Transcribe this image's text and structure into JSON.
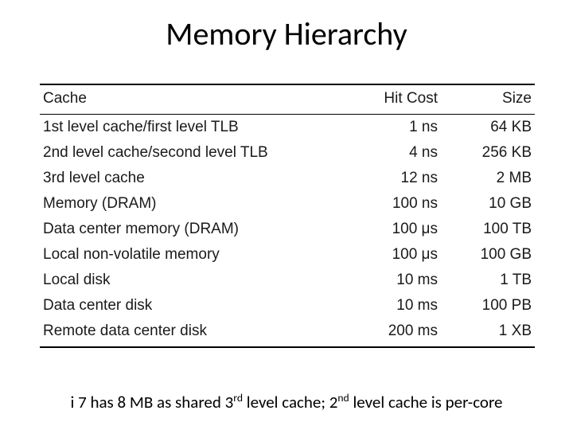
{
  "title": "Memory Hierarchy",
  "columns": {
    "cache": "Cache",
    "hit": "Hit Cost",
    "size": "Size"
  },
  "rows": [
    {
      "cache": "1st level cache/first level TLB",
      "hit": "1 ns",
      "size": "64 KB"
    },
    {
      "cache": "2nd level cache/second level TLB",
      "hit": "4 ns",
      "size": "256 KB"
    },
    {
      "cache": "3rd level cache",
      "hit": "12 ns",
      "size": "2 MB"
    },
    {
      "cache": "Memory (DRAM)",
      "hit": "100 ns",
      "size": "10 GB"
    },
    {
      "cache": "Data center memory (DRAM)",
      "hit": "100 μs",
      "size": "100 TB"
    },
    {
      "cache": "Local non-volatile memory",
      "hit": "100 μs",
      "size": "100 GB"
    },
    {
      "cache": "Local disk",
      "hit": "10 ms",
      "size": "1 TB"
    },
    {
      "cache": "Data center disk",
      "hit": "10 ms",
      "size": "100 PB"
    },
    {
      "cache": "Remote data center disk",
      "hit": "200 ms",
      "size": "1 XB"
    }
  ],
  "footnote": {
    "p1": "i 7 has 8 MB as shared 3",
    "s1": "rd",
    "p2": " level cache; 2",
    "s2": "nd",
    "p3": " level cache is per-core"
  }
}
